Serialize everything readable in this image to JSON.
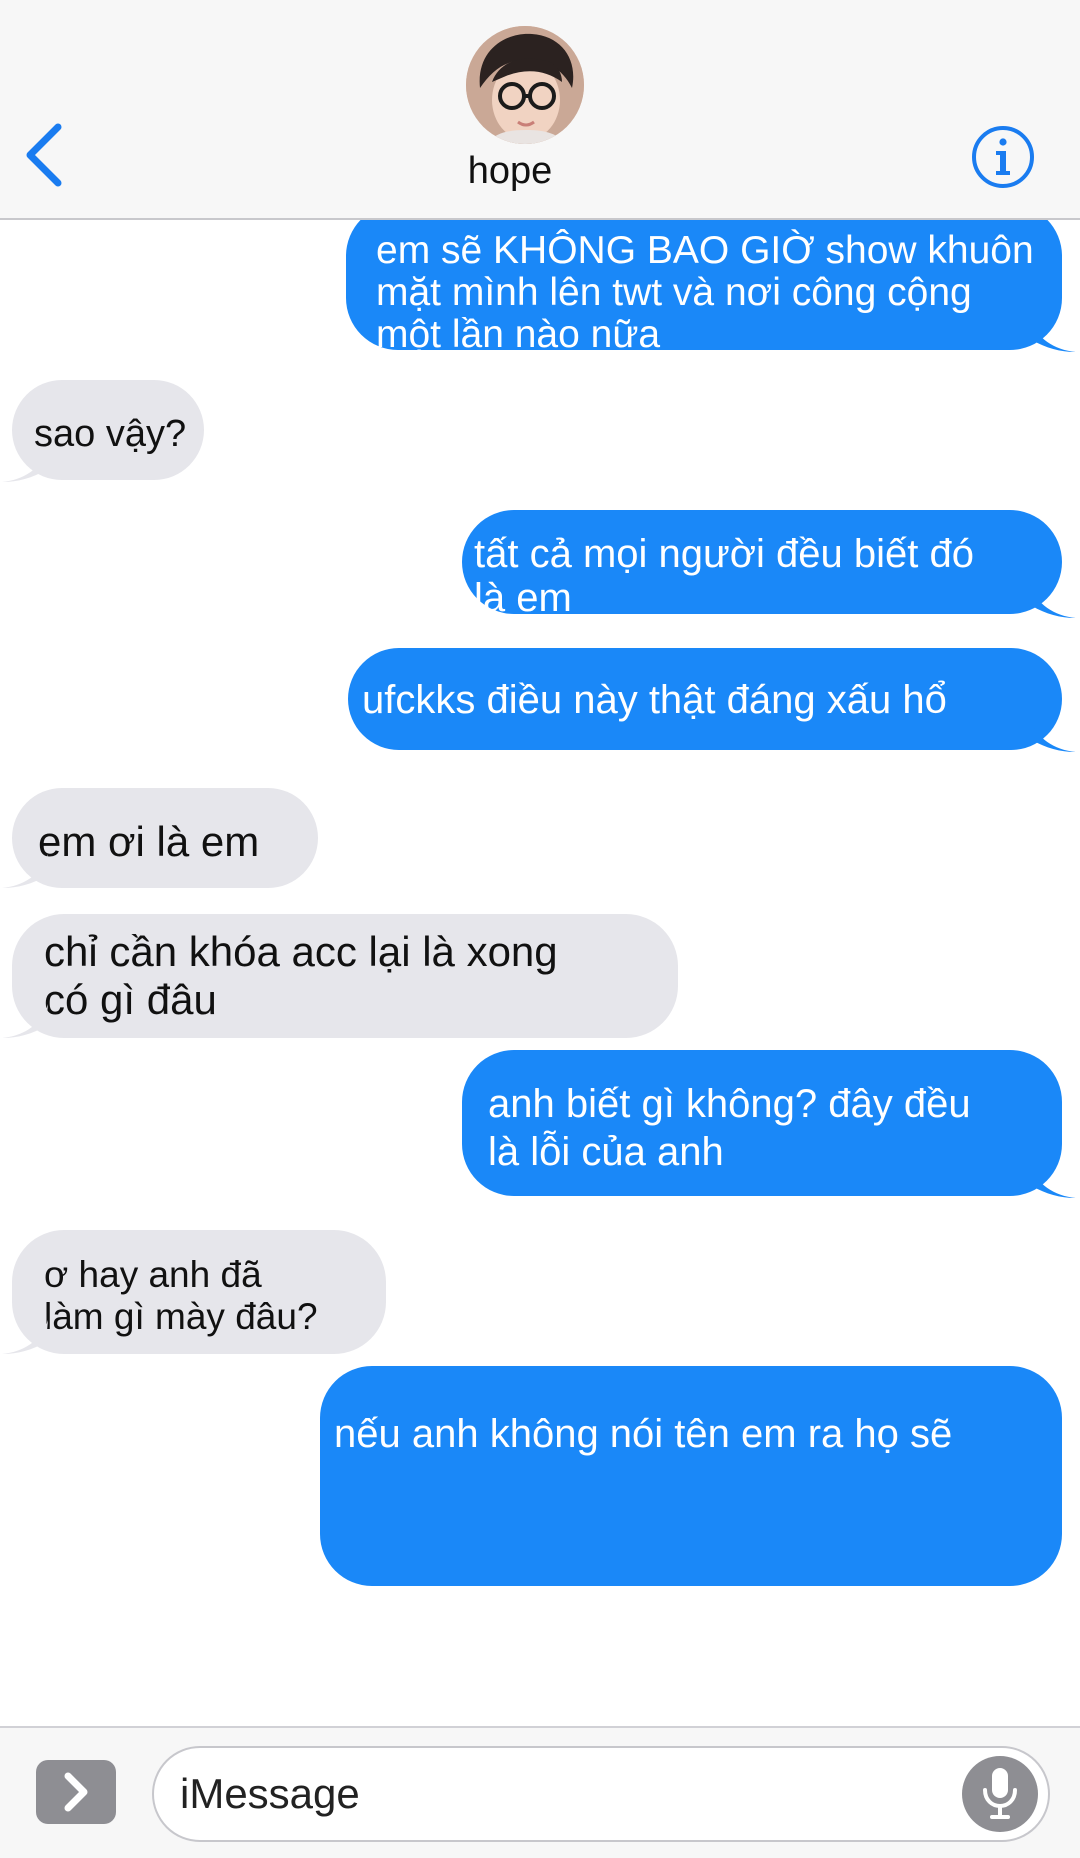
{
  "header": {
    "contact_name": "hope",
    "back_icon": "chevron-left-icon",
    "info_icon": "info-circle-icon",
    "accent_color": "#1a7cf0"
  },
  "messages": [
    {
      "direction": "sent",
      "text": "em sẽ KHÔNG BAO GIỜ show khuôn\nmặt mình lên  twt và nơi công cộng\nmột lần nào nữa"
    },
    {
      "direction": "received",
      "text": "sao vậy?"
    },
    {
      "direction": "sent",
      "text": "tất cả mọi người đều biết đó\nlà em"
    },
    {
      "direction": "sent",
      "text": "ufckks điều này thật đáng xấu hổ"
    },
    {
      "direction": "received",
      "text": "em ơi là em"
    },
    {
      "direction": "received",
      "text": "chỉ cần khóa acc lại là xong\ncó gì đâu"
    },
    {
      "direction": "sent",
      "text": "anh biết gì không? đây đều\nlà lỗi của anh"
    },
    {
      "direction": "received",
      "text": "ơ hay anh đã\nlàm gì mày đâu?"
    },
    {
      "direction": "sent",
      "text": "nếu anh không nói tên em ra họ sẽ"
    }
  ],
  "input_bar": {
    "placeholder": "iMessage",
    "apps_icon": "chevron-right-icon",
    "mic_icon": "microphone-icon"
  },
  "colors": {
    "sent_bubble": "#1a88f8",
    "received_bubble": "#e6e6eb"
  }
}
